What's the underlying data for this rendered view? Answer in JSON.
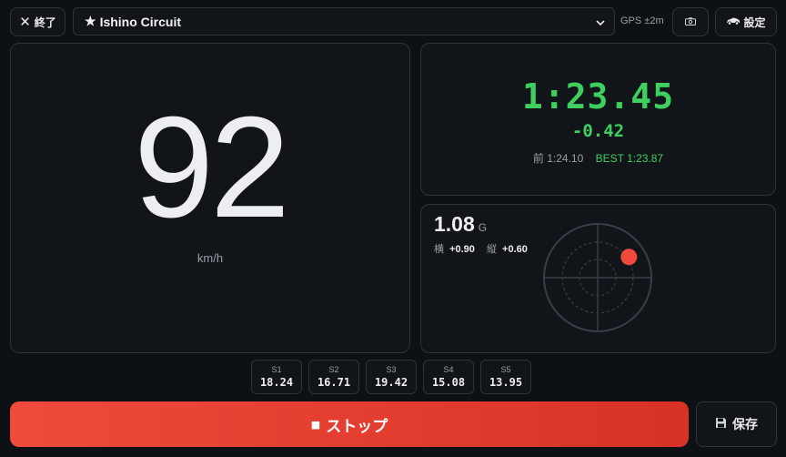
{
  "header": {
    "close_label": "終了",
    "track_name": "Ishino Circuit",
    "gps_status": "GPS ±2m",
    "settings_label": "設定"
  },
  "speed": {
    "value": "92",
    "unit": "km/h"
  },
  "lap": {
    "current_time": "1:23.45",
    "delta": "-0.42",
    "prev_label": "前 1:24.10",
    "best_label": "BEST 1:23.87"
  },
  "gforce": {
    "total": "1.08",
    "unit": "G",
    "lateral_label": "横",
    "lateral_value": "+0.90",
    "longitudinal_label": "縦",
    "longitudinal_value": "+0.60"
  },
  "sectors": [
    {
      "name": "S1",
      "time": "18.24"
    },
    {
      "name": "S2",
      "time": "16.71"
    },
    {
      "name": "S3",
      "time": "19.42"
    },
    {
      "name": "S4",
      "time": "15.08"
    },
    {
      "name": "S5",
      "time": "13.95"
    }
  ],
  "controls": {
    "stop_label": "ストップ",
    "save_label": "保存"
  },
  "colors": {
    "accent_green": "#3ecf5f",
    "stop_red": "#e83f32",
    "g_dot": "#f04a3c"
  }
}
